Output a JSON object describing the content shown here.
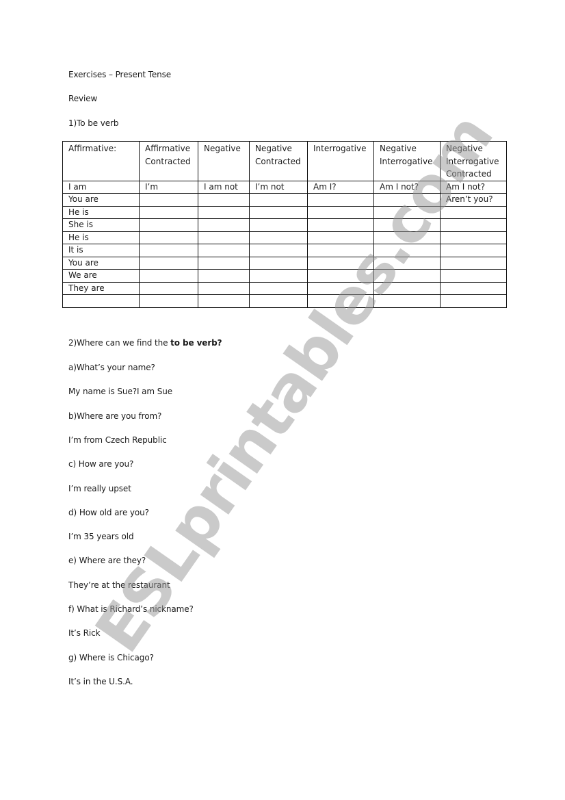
{
  "document": {
    "title": "Exercises – Present Tense",
    "subtitle": "Review",
    "section1_heading": "1)To be verb",
    "table": {
      "headers": [
        "Affirmative:",
        "Affirmative\nContracted",
        "Negative",
        "Negative\nContracted",
        "Interrogative",
        "Negative\nInterrogative",
        "Negative\nInterrogative\nContracted"
      ],
      "rows": [
        [
          "I am",
          "I’m",
          "I am not",
          "I’m not",
          "Am I?",
          "Am I not?",
          "Am I not?"
        ],
        [
          "You are",
          "",
          "",
          "",
          "",
          "",
          "Aren’t you?"
        ],
        [
          "He is",
          "",
          "",
          "",
          "",
          "",
          ""
        ],
        [
          "She is",
          "",
          "",
          "",
          "",
          "",
          ""
        ],
        [
          "He is",
          "",
          "",
          "",
          "",
          "",
          ""
        ],
        [
          "It is",
          "",
          "",
          "",
          "",
          "",
          ""
        ],
        [
          "You are",
          "",
          "",
          "",
          "",
          "",
          ""
        ],
        [
          "We are",
          "",
          "",
          "",
          "",
          "",
          ""
        ],
        [
          "They are",
          "",
          "",
          "",
          "",
          "",
          ""
        ],
        [
          "",
          "",
          "",
          "",
          "",
          "",
          ""
        ]
      ]
    },
    "section2": {
      "heading_prefix": "2)Where can we find the ",
      "heading_bold": "to be verb?",
      "items": [
        "a)What’s your name?",
        "My name is Sue?I am Sue",
        "b)Where are you from?",
        "I’m from Czech Republic",
        "c) How are you?",
        "I’m really upset",
        "d) How old are you?",
        "I’m 35 years old",
        "e)  Where are they?",
        "They’re at the restaurant",
        "f) What is Richard’s nickname?",
        "It’s Rick",
        "g) Where is Chicago?",
        "It’s in the U.S.A."
      ]
    },
    "watermark": "ESLprintables.com"
  }
}
